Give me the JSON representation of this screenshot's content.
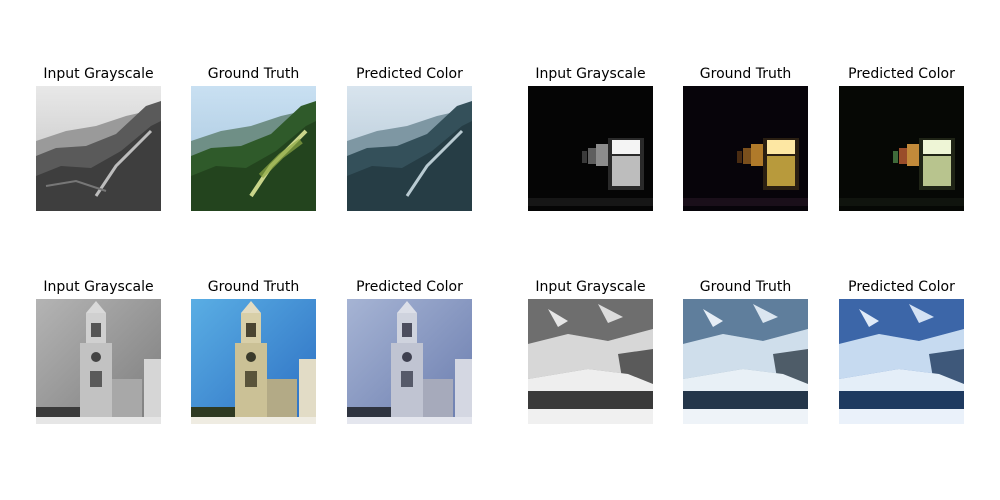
{
  "figure": {
    "groups": [
      {
        "scene": "mountain forest",
        "panels": [
          {
            "title": "Input Grayscale",
            "kind": "grayscale"
          },
          {
            "title": "Ground Truth",
            "kind": "truth"
          },
          {
            "title": "Predicted Color",
            "kind": "predicted"
          }
        ]
      },
      {
        "scene": "night lanterns",
        "panels": [
          {
            "title": "Input Grayscale",
            "kind": "grayscale"
          },
          {
            "title": "Ground Truth",
            "kind": "truth"
          },
          {
            "title": "Predicted Color",
            "kind": "predicted"
          }
        ]
      },
      {
        "scene": "church tower",
        "panels": [
          {
            "title": "Input Grayscale",
            "kind": "grayscale"
          },
          {
            "title": "Ground Truth",
            "kind": "truth"
          },
          {
            "title": "Predicted Color",
            "kind": "predicted"
          }
        ]
      },
      {
        "scene": "glacier",
        "panels": [
          {
            "title": "Input Grayscale",
            "kind": "grayscale"
          },
          {
            "title": "Ground Truth",
            "kind": "truth"
          },
          {
            "title": "Predicted Color",
            "kind": "predicted"
          }
        ]
      }
    ]
  }
}
